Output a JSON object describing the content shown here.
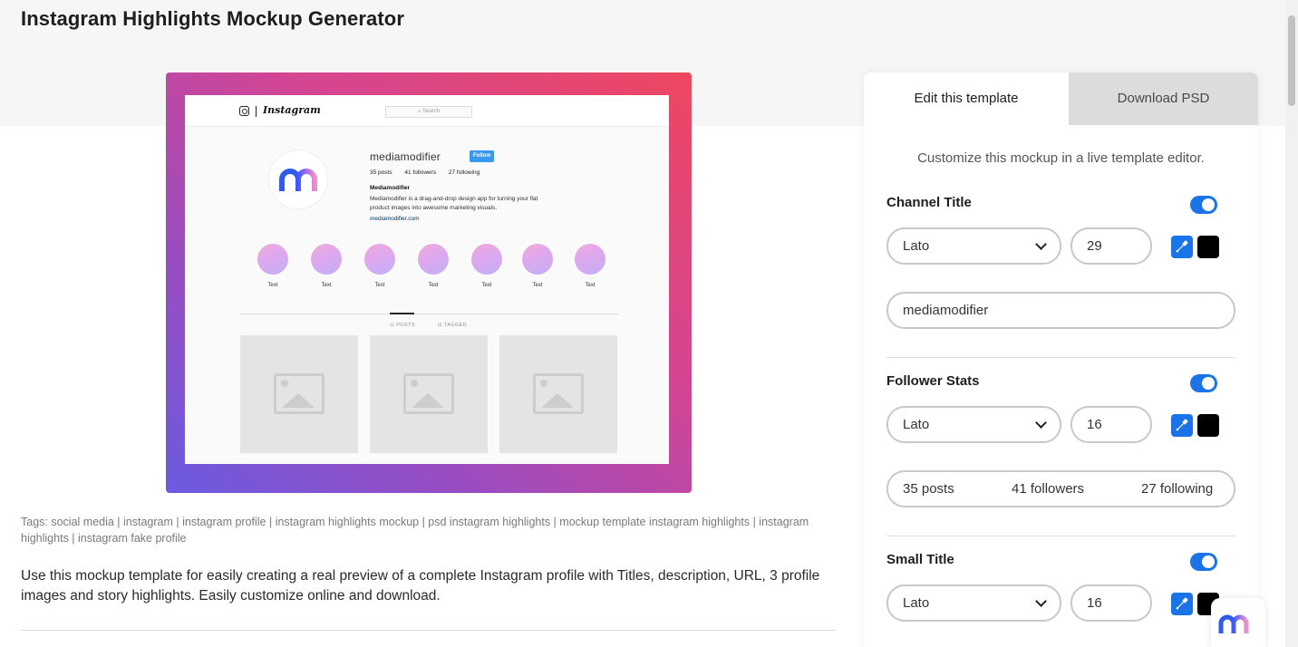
{
  "page": {
    "title": "Instagram Highlights Mockup Generator",
    "tags": "Tags: social media | instagram | instagram profile | instagram highlights mockup | psd instagram highlights | mockup template instagram highlights | instagram highlights | instagram fake profile",
    "description": "Use this mockup template for easily creating a real preview of a complete Instagram profile with Titles, description, URL, 3 profile images and story highlights. Easily customize online and download."
  },
  "mockup": {
    "nav": {
      "wordmark": "Instagram",
      "search_placeholder": "⌕ Search"
    },
    "profile": {
      "username": "mediamodifier",
      "follow_label": "Follow",
      "stats": [
        "35 posts",
        "41 followers",
        "27 following"
      ],
      "bio_title": "Mediamodifier",
      "bio_text": "Mediamodifier is a drag-and-drop design app for turning your flat product images into awesome marketing visuals.",
      "link": "mediamodifier.com"
    },
    "highlights": [
      "Text",
      "Text",
      "Text",
      "Text",
      "Text",
      "Text",
      "Text"
    ],
    "tabs": {
      "posts": "☷ POSTS",
      "tagged": "⊡ TAGGED"
    },
    "gradient_colors": [
      "#6a5be0",
      "#d44592",
      "#ee4760"
    ]
  },
  "panel": {
    "tabs": {
      "edit": "Edit this template",
      "download": "Download PSD"
    },
    "subtitle": "Customize this mockup in a live template editor.",
    "sections": {
      "channel_title": {
        "label": "Channel Title",
        "enabled": true,
        "font": "Lato",
        "size": "29",
        "color": "#000000",
        "value": "mediamodifier"
      },
      "follower_stats": {
        "label": "Follower Stats",
        "enabled": true,
        "font": "Lato",
        "size": "16",
        "color": "#000000",
        "values": [
          "35 posts",
          "41 followers",
          "27 following"
        ]
      },
      "small_title": {
        "label": "Small Title",
        "enabled": true,
        "font": "Lato",
        "size": "16",
        "color": "#000000"
      }
    },
    "accent": "#1a73e8"
  }
}
